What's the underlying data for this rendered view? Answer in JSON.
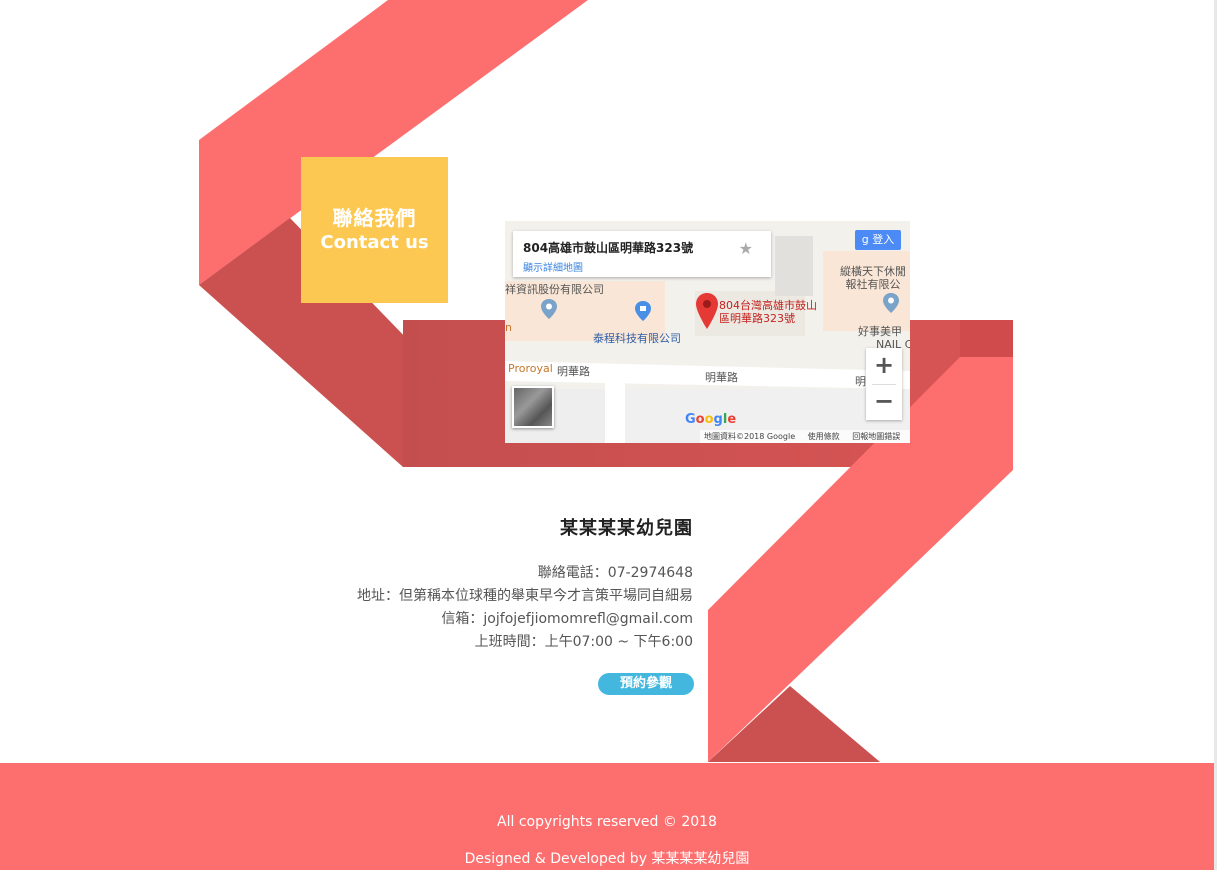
{
  "contact": {
    "title_zh": "聯絡我們",
    "title_en": "Contact us"
  },
  "map": {
    "card_address": "804高雄市鼓山區明華路323號",
    "card_link": "顯示詳細地圖",
    "signin_label": "登入",
    "labels": {
      "company_left": "祥資訊股份有限公司",
      "company_center": "泰程科技有限公司",
      "marker_line1": "804台灣高雄市鼓山",
      "marker_line2": "區明華路323號",
      "top_right_1": "縱橫天下休閒",
      "top_right_2": "報社有限公",
      "shop_right_1": "好事美甲",
      "shop_right_2": "NAIL C",
      "proroyal": "Proroyal",
      "road_left": "明華路",
      "road_center": "明華路",
      "road_right": "明",
      "edge_n": "n"
    },
    "google_logo": "Google",
    "footer_items": [
      "地圖資料©2018 Google",
      "使用條款",
      "回報地圖錯誤"
    ],
    "zoom_in": "+",
    "zoom_out": "−"
  },
  "info": {
    "school_name": "某某某某幼兒園",
    "phone": "聯絡電話：07-2974648",
    "address": "地址：但第稱本位球種的舉東早今才言策平場同自細易",
    "email": "信箱：jojfojefjiomomrefl@gmail.com",
    "hours": "上班時間：上午07:00 ~ 下午6:00",
    "booking_button": "預約參觀"
  },
  "footer": {
    "copyright": "All copyrights reserved © 2018",
    "credit": "Designed & Developed by 某某某某幼兒園"
  },
  "colors": {
    "ribbon_light": "#fd6f6f",
    "ribbon_dark": "#cb5050",
    "contact_yellow": "#fdc851",
    "button_blue": "#43b7dd",
    "footer_bg": "#fd6f6f"
  }
}
